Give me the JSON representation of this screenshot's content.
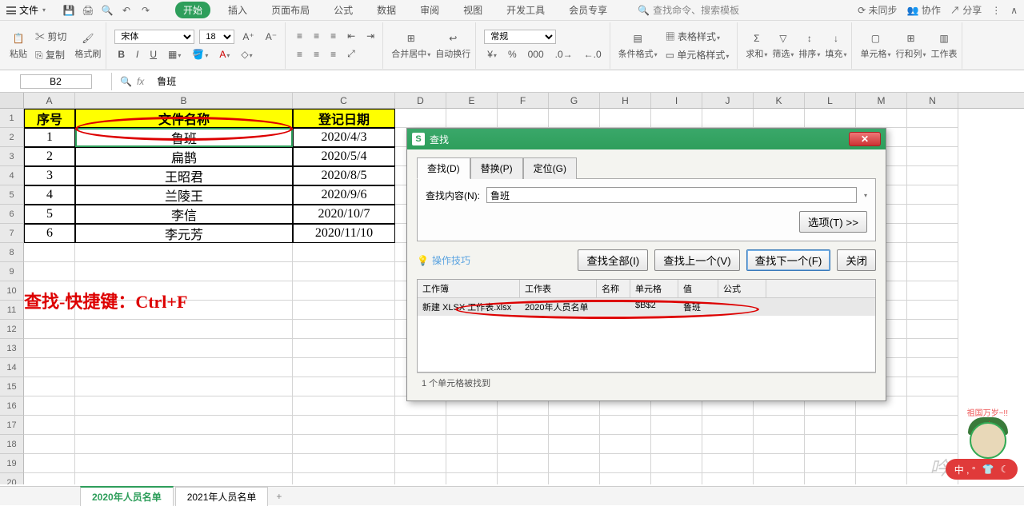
{
  "menubar": {
    "file": "文件",
    "tabs": [
      "开始",
      "插入",
      "页面布局",
      "公式",
      "数据",
      "审阅",
      "视图",
      "开发工具",
      "会员专享"
    ],
    "active_tab": 0,
    "search_placeholder": "查找命令、搜索模板",
    "right": {
      "sync": "未同步",
      "collab": "协作",
      "share": "分享"
    }
  },
  "ribbon": {
    "paste": "粘贴",
    "cut": "剪切",
    "copy": "复制",
    "format_painter": "格式刷",
    "font_name": "宋体",
    "font_size": "18",
    "merge": "合并居中",
    "wrap": "自动换行",
    "number_format": "常规",
    "cond_fmt": "条件格式",
    "table_style": "表格样式",
    "cell_style": "单元格样式",
    "sum": "求和",
    "filter": "筛选",
    "sort": "排序",
    "fill": "填充",
    "cell": "单元格",
    "rowcol": "行和列",
    "worksheet": "工作表"
  },
  "formula_bar": {
    "cell_ref": "B2",
    "fx": "fx",
    "value": "鲁班"
  },
  "columns": [
    "A",
    "B",
    "C",
    "D",
    "E",
    "F",
    "G",
    "H",
    "I",
    "J",
    "K",
    "L",
    "M",
    "N"
  ],
  "table": {
    "headers": {
      "A": "序号",
      "B": "文件名称",
      "C": "登记日期"
    },
    "rows": [
      {
        "A": "1",
        "B": "鲁班",
        "C": "2020/4/3"
      },
      {
        "A": "2",
        "B": "扁鹊",
        "C": "2020/5/4"
      },
      {
        "A": "3",
        "B": "王昭君",
        "C": "2020/8/5"
      },
      {
        "A": "4",
        "B": "兰陵王",
        "C": "2020/9/6"
      },
      {
        "A": "5",
        "B": "李信",
        "C": "2020/10/7"
      },
      {
        "A": "6",
        "B": "李元芳",
        "C": "2020/11/10"
      }
    ]
  },
  "annotation": "查找-快捷键：Ctrl+F",
  "watermark": "吟羽",
  "dialog": {
    "title": "查找",
    "tabs": {
      "find": "查找(D)",
      "replace": "替换(P)",
      "goto": "定位(G)"
    },
    "find_label": "查找内容(N):",
    "find_value": "鲁班",
    "options_btn": "选项(T) >>",
    "tips": "操作技巧",
    "btn_find_all": "查找全部(I)",
    "btn_find_prev": "查找上一个(V)",
    "btn_find_next": "查找下一个(F)",
    "btn_close": "关闭",
    "result_headers": {
      "wb": "工作簿",
      "ws": "工作表",
      "name": "名称",
      "cell": "单元格",
      "value": "值",
      "formula": "公式"
    },
    "result_row": {
      "wb": "新建 XLSX 工作表.xlsx",
      "ws": "2020年人员名单",
      "name": "",
      "cell": "$B$2",
      "value": "鲁班",
      "formula": ""
    },
    "status": "1 个单元格被找到"
  },
  "sheets": {
    "s1": "2020年人员名单",
    "s2": "2021年人员名单"
  },
  "mascot": {
    "bubble": "祖国万岁~!!",
    "pill": "中 , °"
  }
}
